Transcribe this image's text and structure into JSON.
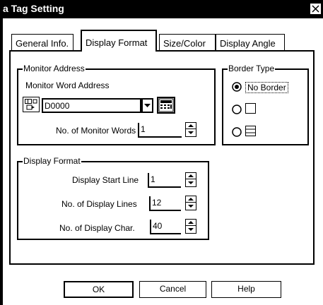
{
  "window": {
    "title": "a Tag Setting"
  },
  "tabs": [
    {
      "label": "General Info."
    },
    {
      "label": "Display Format"
    },
    {
      "label": "Size/Color"
    },
    {
      "label": "Display Angle"
    }
  ],
  "monitor_address": {
    "group_label": "Monitor Address",
    "word_address_label": "Monitor Word Address",
    "address_value": "D0000",
    "num_words_label": "No. of Monitor Words",
    "num_words_value": "1"
  },
  "border_type": {
    "group_label": "Border Type",
    "options": [
      {
        "label": "No Border",
        "selected": true
      },
      {
        "label": "",
        "selected": false
      },
      {
        "label": "",
        "selected": false
      }
    ]
  },
  "display_format": {
    "group_label": "Display Format",
    "start_line_label": "Display Start Line",
    "start_line_value": "1",
    "num_lines_label": "No. of Display Lines",
    "num_lines_value": "12",
    "num_chars_label": "No. of Display Char.",
    "num_chars_value": "40"
  },
  "buttons": {
    "ok": "OK",
    "cancel": "Cancel",
    "help": "Help"
  }
}
